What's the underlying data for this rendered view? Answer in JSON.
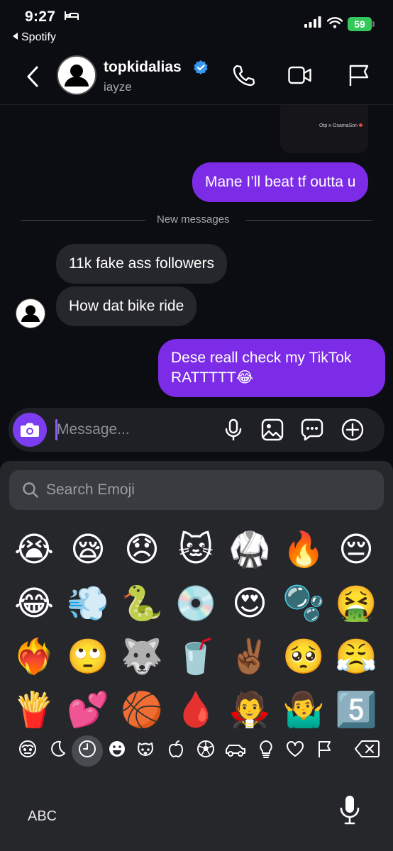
{
  "status_bar": {
    "time": "9:27",
    "back_app": "Spotify",
    "battery": "59"
  },
  "header": {
    "username": "topkidalias",
    "subtitle": "iayze"
  },
  "shared_media": {
    "caption": "Otp ʜ OsamaSon"
  },
  "messages": [
    {
      "direction": "outgoing",
      "text": "Mane I’ll beat tf outta u"
    },
    {
      "direction": "incoming",
      "text": "11k fake ass followers"
    },
    {
      "direction": "incoming",
      "text": "How dat bike ride"
    },
    {
      "direction": "outgoing",
      "text": "Dese reall check my TikTok",
      "text_line2": "RATTTTT😂"
    }
  ],
  "divider": {
    "label": "New messages"
  },
  "composer": {
    "placeholder": "Message..."
  },
  "keyboard": {
    "search_placeholder": "Search Emoji",
    "emoji_rows": [
      [
        "😭",
        "😪",
        "😞",
        "🐱",
        "🥋",
        "🔥",
        "😔"
      ],
      [
        "😂",
        "💨",
        "🐍",
        "💿",
        "😍",
        "🫧",
        "🤮"
      ],
      [
        "❤️‍🔥",
        "🙄",
        "🐺",
        "🥤",
        "✌🏾",
        "🥺",
        "😤"
      ],
      [
        "🍟",
        "💕",
        "🏀",
        "🩸",
        "🧛",
        "🤷‍♂️",
        "5️⃣"
      ]
    ],
    "abc_label": "ABC"
  },
  "colors": {
    "outgoing_bubble": "#7c2ce6",
    "incoming_bubble": "#26272c",
    "camera_button": "#7c3cf0",
    "verified_badge": "#3897f0",
    "battery": "#34c759"
  }
}
